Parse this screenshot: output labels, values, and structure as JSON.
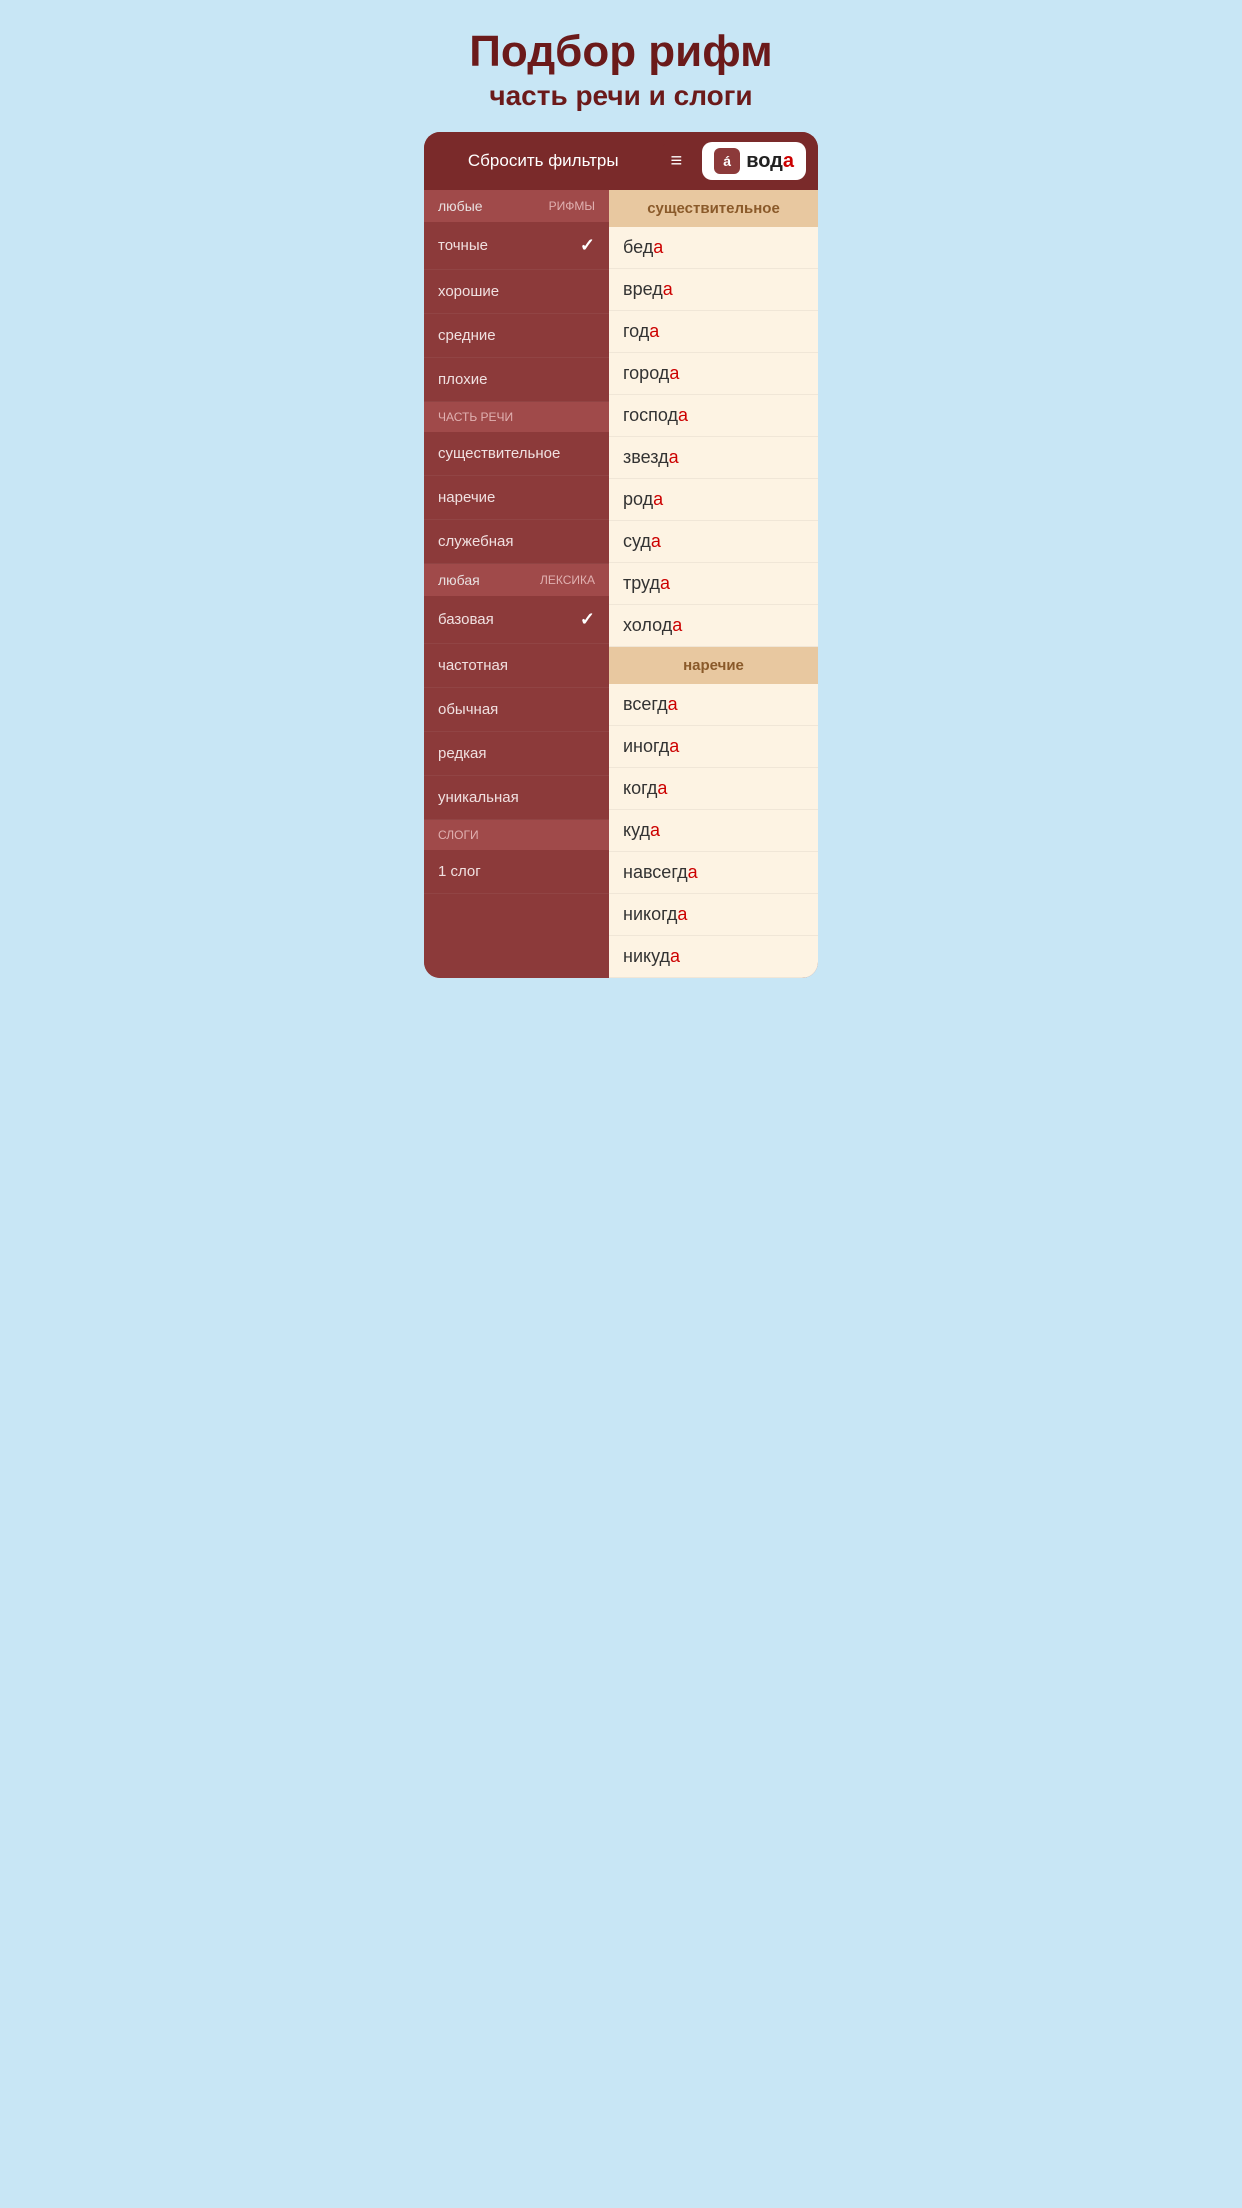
{
  "header": {
    "title": "Подбор рифм",
    "subtitle": "часть речи и слоги"
  },
  "toolbar": {
    "reset_label": "Сбросить фильтры",
    "menu_icon": "≡",
    "word_icon": "á",
    "word_prefix": "вод",
    "word_accent": "а"
  },
  "left_panel": {
    "rhymes_section": {
      "label": "РИФМЫ",
      "value": "любые",
      "items": [
        {
          "text": "точные",
          "checked": true
        },
        {
          "text": "хорошие",
          "checked": false
        },
        {
          "text": "средние",
          "checked": false
        },
        {
          "text": "плохие",
          "checked": false
        }
      ]
    },
    "pos_section": {
      "label": "ЧАСТЬ РЕЧИ",
      "items": [
        {
          "text": "существительное",
          "checked": false
        },
        {
          "text": "наречие",
          "checked": false
        },
        {
          "text": "служебная",
          "checked": false
        }
      ]
    },
    "lexics_section": {
      "label": "ЛЕКСИКА",
      "value": "любая",
      "items": [
        {
          "text": "базовая",
          "checked": true
        },
        {
          "text": "частотная",
          "checked": false
        },
        {
          "text": "обычная",
          "checked": false
        },
        {
          "text": "редкая",
          "checked": false
        },
        {
          "text": "уникальная",
          "checked": false
        }
      ]
    },
    "syllables_section": {
      "label": "СЛОГИ",
      "items": [
        {
          "text": "1 слог",
          "checked": false
        }
      ]
    }
  },
  "right_panel": {
    "noun_section": {
      "header": "существительное",
      "items": [
        {
          "prefix": "бед",
          "accent": "а"
        },
        {
          "prefix": "вред",
          "accent": "а"
        },
        {
          "prefix": "год",
          "accent": "а"
        },
        {
          "prefix": "город",
          "accent": "а"
        },
        {
          "prefix": "господ",
          "accent": "а"
        },
        {
          "prefix": "звезд",
          "accent": "а"
        },
        {
          "prefix": "род",
          "accent": "а"
        },
        {
          "prefix": "суд",
          "accent": "а"
        },
        {
          "prefix": "труд",
          "accent": "а"
        },
        {
          "prefix": "холод",
          "accent": "а"
        }
      ]
    },
    "adverb_section": {
      "header": "наречие",
      "items": [
        {
          "prefix": "всегд",
          "accent": "а"
        },
        {
          "prefix": "иногд",
          "accent": "а"
        },
        {
          "prefix": "когд",
          "accent": "а"
        },
        {
          "prefix": "куд",
          "accent": "а"
        },
        {
          "prefix": "навсегд",
          "accent": "а"
        },
        {
          "prefix": "никогд",
          "accent": "а"
        },
        {
          "prefix": "никуд",
          "accent": "а"
        }
      ]
    }
  }
}
